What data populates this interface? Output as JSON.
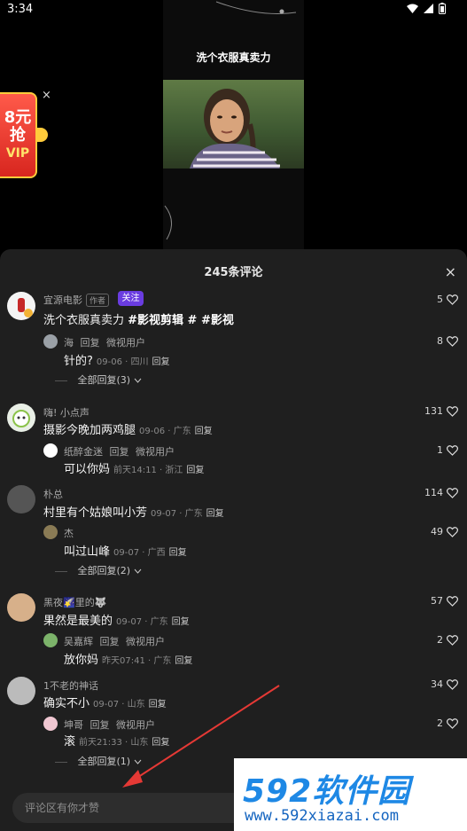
{
  "status": {
    "time": "3:34"
  },
  "video": {
    "title": "洗个衣服真卖力"
  },
  "promo": {
    "price": "8元",
    "action": "抢",
    "vip": "VIP",
    "close": "×"
  },
  "panel": {
    "title": "245条评论",
    "close": "×"
  },
  "comments": [
    {
      "user": "宜源电影",
      "author_tag": "作者",
      "follow": "关注",
      "text_plain": "洗个衣服真卖力 ",
      "hashtags": "#影视剪辑 # #影视",
      "likes": "5",
      "replies": [
        {
          "user": "海",
          "reply_label": "回复",
          "reply_to": "微视用户",
          "text": "针的?",
          "date": "09-06 · 四川",
          "reply": "回复",
          "likes": "8"
        }
      ],
      "expand": "全部回复(3)"
    },
    {
      "user": "嗨! 小点声",
      "text": "摄影今晚加两鸡腿",
      "date": "09-06 · 广东",
      "reply": "回复",
      "likes": "131",
      "replies": [
        {
          "user": "纸醉金迷",
          "reply_label": "回复",
          "reply_to": "微视用户",
          "text": "可以你妈",
          "date": "前天14:11 · 浙江",
          "reply": "回复",
          "likes": "1"
        }
      ]
    },
    {
      "user": "朴总",
      "text": "村里有个姑娘叫小芳",
      "date": "09-07 · 广东",
      "reply": "回复",
      "likes": "114",
      "replies": [
        {
          "user": "杰",
          "text": "叫过山峰",
          "date": "09-07 · 广西",
          "reply": "回复",
          "likes": "49"
        }
      ],
      "expand": "全部回复(2)"
    },
    {
      "user": "黑夜🌠里的🐺",
      "text": "果然是最美的",
      "date": "09-07 · 广东",
      "reply": "回复",
      "likes": "57",
      "replies": [
        {
          "user": "吴嘉辉",
          "reply_label": "回复",
          "reply_to": "微视用户",
          "text": "放你妈",
          "date": "昨天07:41 · 广东",
          "reply": "回复",
          "likes": "2"
        }
      ]
    },
    {
      "user": "1不老的神话",
      "text": "确实不小",
      "date": "09-07 · 山东",
      "reply": "回复",
      "likes": "34",
      "replies": [
        {
          "user": "坤哥",
          "reply_label": "回复",
          "reply_to": "微视用户",
          "text": "滚",
          "date": "前天21:33 · 山东",
          "reply": "回复",
          "likes": "2"
        }
      ],
      "expand": "全部回复(1)"
    }
  ],
  "input": {
    "placeholder": "评论区有你才赞"
  },
  "watermark": {
    "logo": "592软件园",
    "url": "www.592xiazai.com"
  },
  "colors": {
    "panel_bg": "#1f1f1f",
    "follow": "#6a3ce0",
    "annotation_arrow": "#e53935",
    "watermark_blue": "#1e88e5"
  }
}
